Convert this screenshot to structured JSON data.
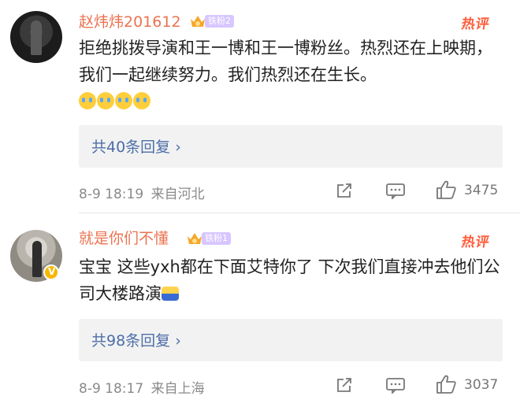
{
  "comments": [
    {
      "username": "赵炜炜201612",
      "fan_badge": "铁粉2",
      "hot_tag": "热评",
      "text": "拒绝挑拨导演和王一博和王一博粉丝。热烈还在上映期，我们一起继续努力。我们热烈还在生长。",
      "emoji_count": 4,
      "replies_label": "共40条回复 ›",
      "timestamp": "8-9 18:19",
      "location": "来自河北",
      "likes": "3475",
      "verified": false
    },
    {
      "username": "就是你们不懂",
      "fan_badge": "铁粉1",
      "hot_tag": "热评",
      "text": "宝宝 这些yxh都在下面艾特你了 下次我们直接冲去他们公司大楼路演",
      "emoji_count": 1,
      "replies_label": "共98条回复 ›",
      "timestamp": "8-9 18:17",
      "location": "来自上海",
      "likes": "3037",
      "verified": true
    }
  ],
  "icons": {
    "crown": "crown-icon",
    "share": "share-icon",
    "comment": "comment-icon",
    "like": "thumbs-up-icon"
  },
  "colors": {
    "username": "#eb7350",
    "hot": "#ff5d3b",
    "reply_link": "#4d6ea8",
    "fan_badge_bg": "#d7c6ff"
  }
}
